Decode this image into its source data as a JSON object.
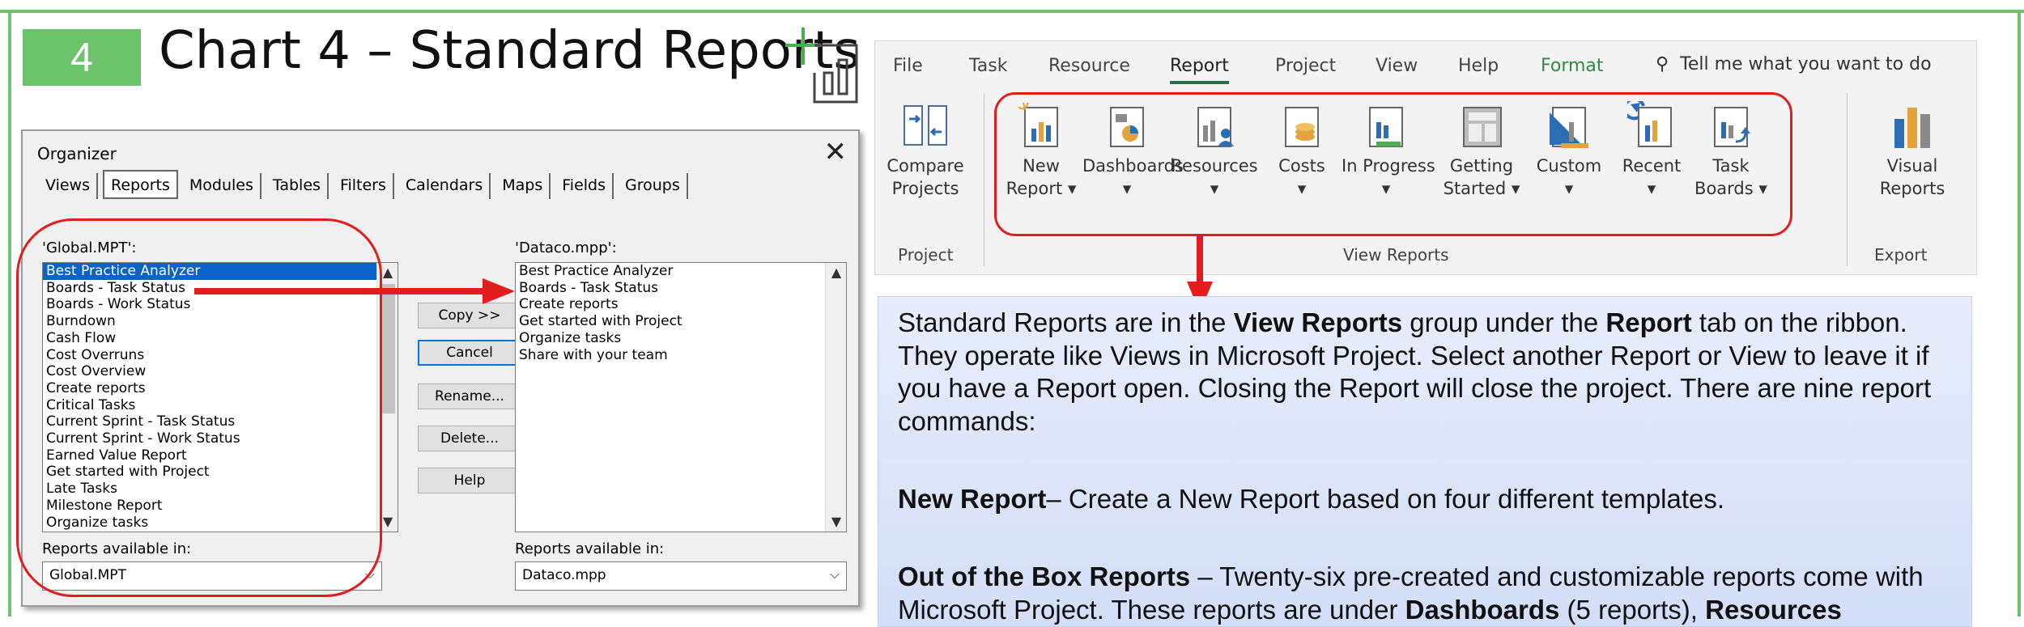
{
  "slide": {
    "number": "4",
    "title": "Chart 4 – Standard Reports",
    "title_icon": "add-chart-icon",
    "accent": "#6cc36c"
  },
  "organizer": {
    "window_title": "Organizer",
    "tabs": [
      "Views",
      "Reports",
      "Modules",
      "Tables",
      "Filters",
      "Calendars",
      "Maps",
      "Fields",
      "Groups"
    ],
    "active_tab": "Reports",
    "left_list_label": "'Global.MPT':",
    "left_items": [
      "Best Practice Analyzer",
      "Boards - Task Status",
      "Boards - Work Status",
      "Burndown",
      "Cash Flow",
      "Cost Overruns",
      "Cost Overview",
      "Create reports",
      "Critical Tasks",
      "Current Sprint - Task Status",
      "Current Sprint - Work Status",
      "Earned Value Report",
      "Get started with Project",
      "Late Tasks",
      "Milestone Report",
      "Organize tasks"
    ],
    "selected_item": "Best Practice Analyzer",
    "right_list_label": "'Dataco.mpp':",
    "right_items": [
      "Best Practice Analyzer",
      "Boards - Task Status",
      "Create reports",
      "Get started with Project",
      "Organize tasks",
      "Share with your team"
    ],
    "buttons": {
      "copy": "Copy >>",
      "cancel": "Cancel",
      "rename": "Rename...",
      "delete": "Delete...",
      "help": "Help"
    },
    "left_available_label": "Reports available in:",
    "left_available_value": "Global.MPT",
    "right_available_label": "Reports available in:",
    "right_available_value": "Dataco.mpp"
  },
  "ribbon": {
    "tabs": [
      "File",
      "Task",
      "Resource",
      "Report",
      "Project",
      "View",
      "Help",
      "Format"
    ],
    "active_tab": "Report",
    "tell_me": "Tell me what you want to do",
    "commands": [
      {
        "line1": "Compare",
        "line2": "Projects",
        "icon": "compare-projects-icon"
      },
      {
        "line1": "New",
        "line2": "Report ▾",
        "icon": "new-report-icon"
      },
      {
        "line1": "Dashboards",
        "line2": "▾",
        "icon": "dashboards-icon"
      },
      {
        "line1": "Resources",
        "line2": "▾",
        "icon": "resources-icon"
      },
      {
        "line1": "Costs",
        "line2": "▾",
        "icon": "costs-icon"
      },
      {
        "line1": "In Progress",
        "line2": "▾",
        "icon": "in-progress-icon"
      },
      {
        "line1": "Getting",
        "line2": "Started ▾",
        "icon": "getting-started-icon"
      },
      {
        "line1": "Custom",
        "line2": "▾",
        "icon": "custom-icon"
      },
      {
        "line1": "Recent",
        "line2": "▾",
        "icon": "recent-icon"
      },
      {
        "line1": "Task",
        "line2": "Boards ▾",
        "icon": "task-boards-icon"
      },
      {
        "line1": "Visual",
        "line2": "Reports",
        "icon": "visual-reports-icon"
      }
    ],
    "groups": [
      "Project",
      "View Reports",
      "Export"
    ]
  },
  "textbox": {
    "p1_a": "Standard Reports are in the ",
    "p1_b": "View Reports",
    "p1_c": " group under the ",
    "p1_d": "Report",
    "p1_e": " tab on the ribbon. They operate like Views in Microsoft Project. Select another Report or View to leave it if you have a Report open. Closing the Report will close the project. There are nine report commands:",
    "p2_a": "New Report",
    "p2_b": "– Create a New Report based on four different templates.",
    "p3_a": "Out of the Box Reports",
    "p3_b": " – Twenty-six pre-created and customizable reports come with Microsoft Project. These reports are under ",
    "p3_c": "Dashboards",
    "p3_d": " (5 reports), ",
    "p3_e": "Resources"
  },
  "colors": {
    "annotation_red": "#e11d1d",
    "selection_blue": "#0a63c9",
    "ribbon_active": "#217346"
  }
}
